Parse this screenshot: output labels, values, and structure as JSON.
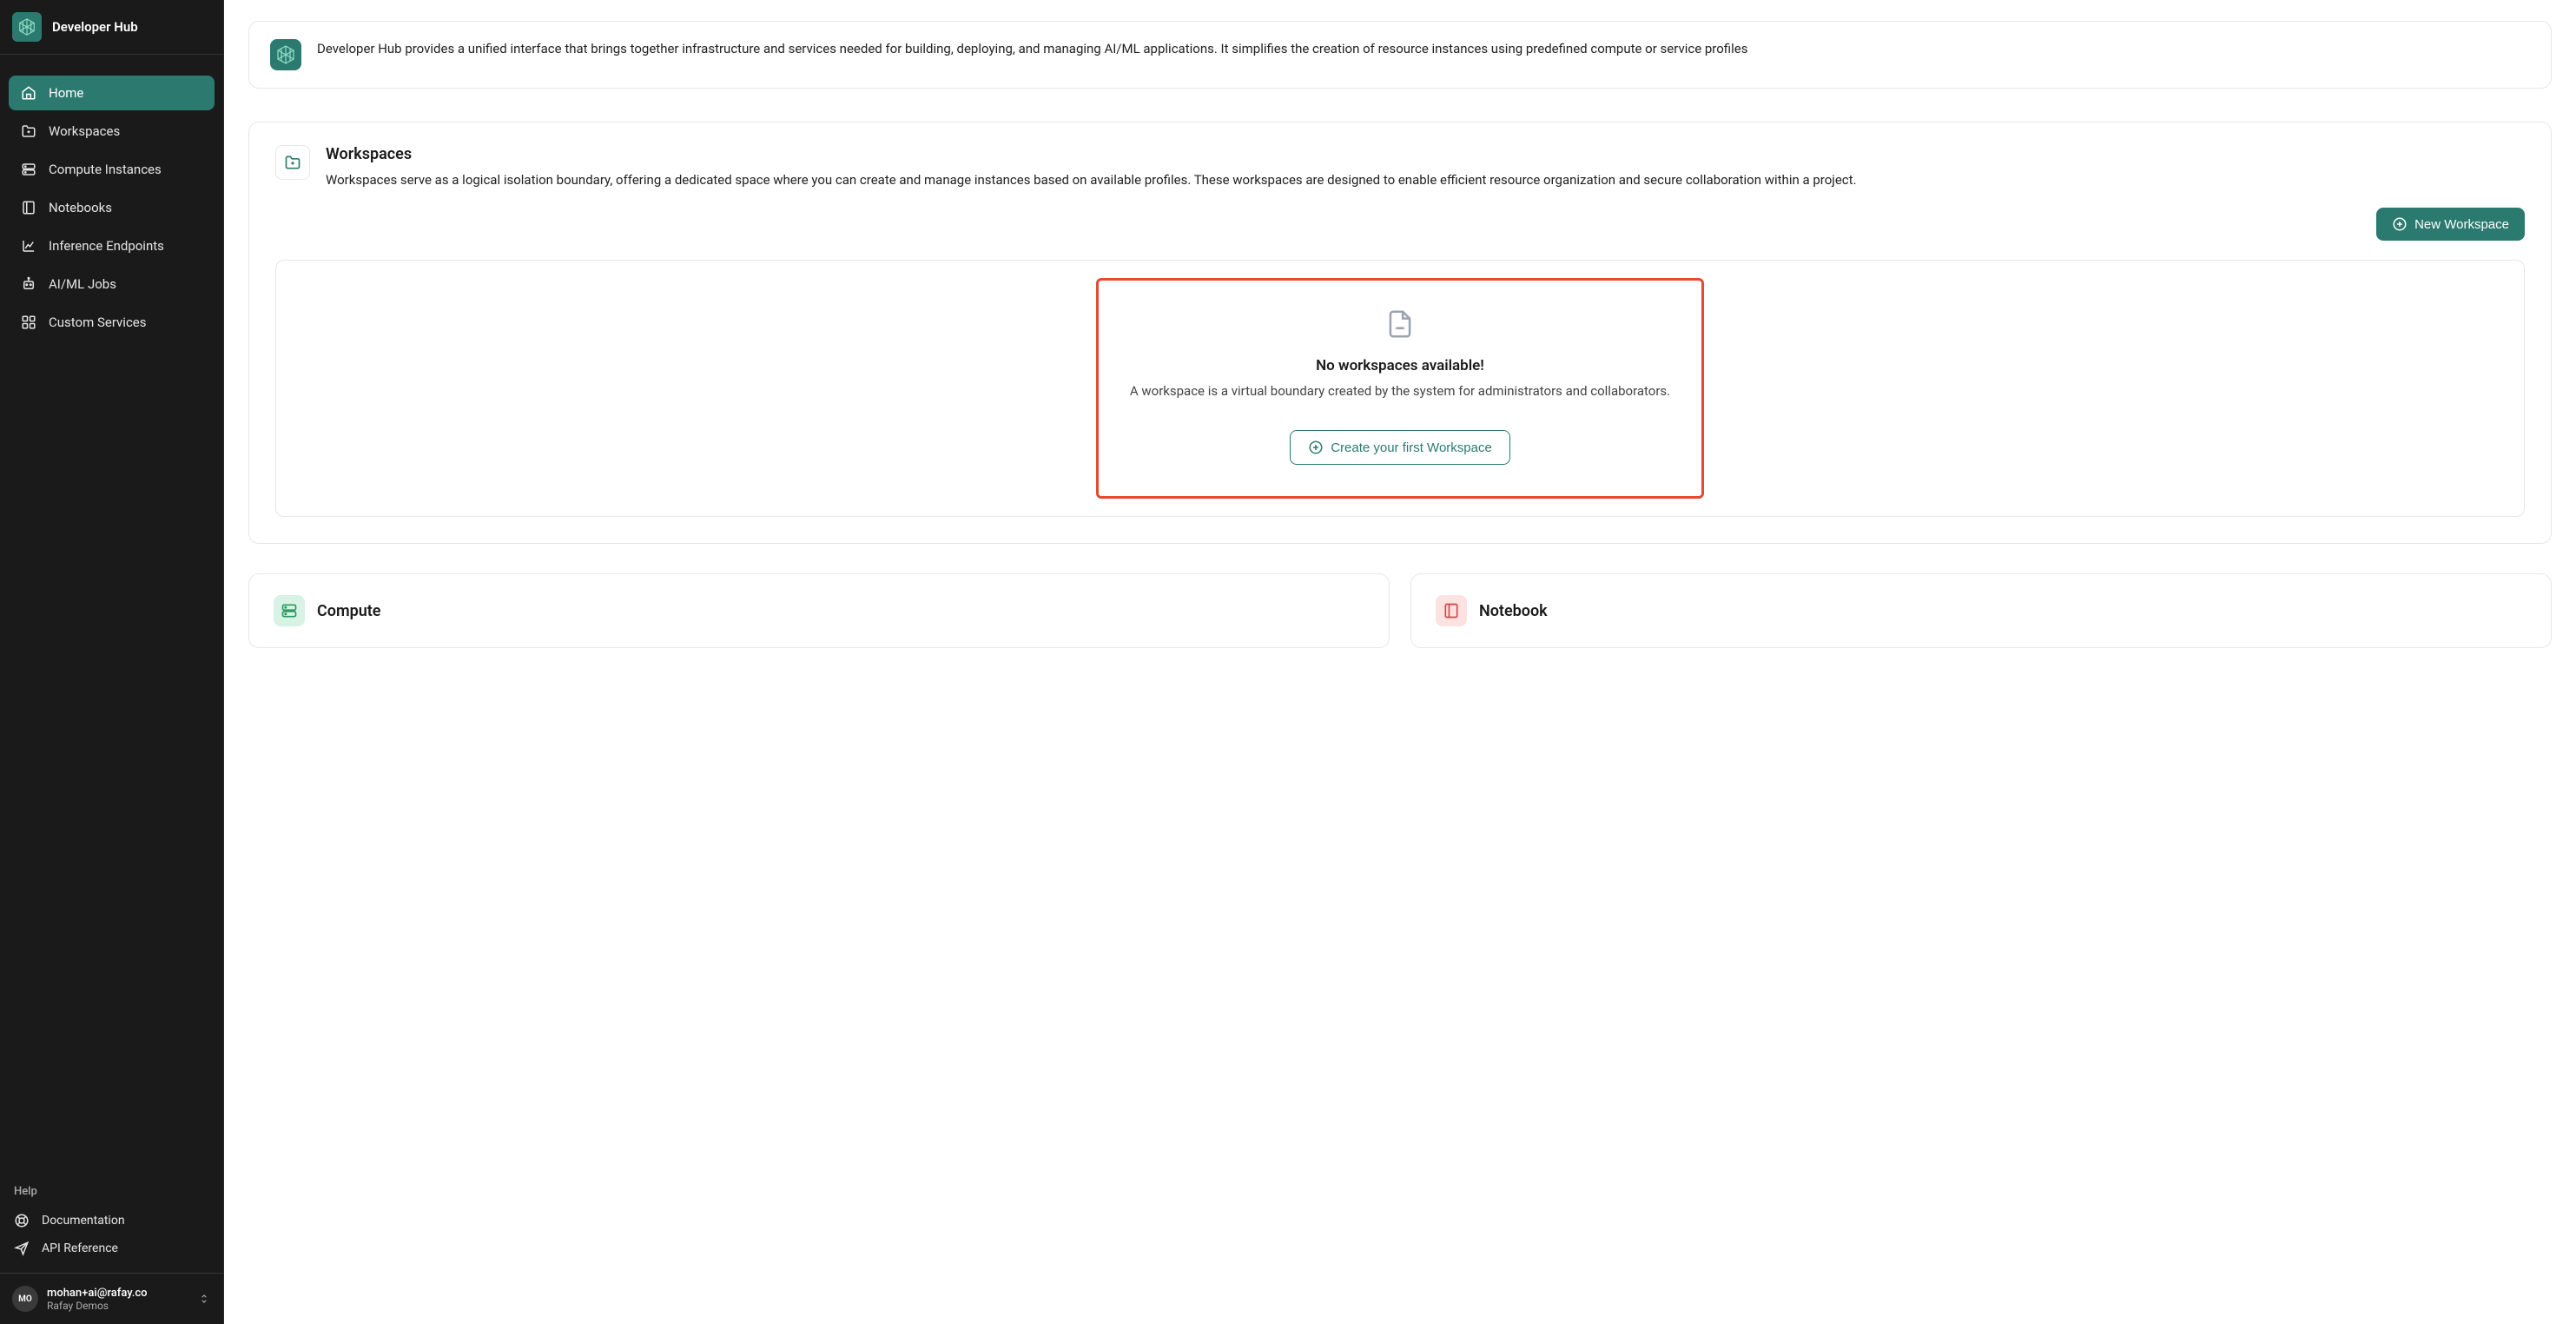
{
  "app": {
    "title": "Developer Hub"
  },
  "sidebar": {
    "items": [
      {
        "label": "Home"
      },
      {
        "label": "Workspaces"
      },
      {
        "label": "Compute Instances"
      },
      {
        "label": "Notebooks"
      },
      {
        "label": "Inference Endpoints"
      },
      {
        "label": "AI/ML Jobs"
      },
      {
        "label": "Custom Services"
      }
    ],
    "help_heading": "Help",
    "help_items": [
      {
        "label": "Documentation"
      },
      {
        "label": "API Reference"
      }
    ]
  },
  "user": {
    "initials": "MO",
    "email": "mohan+ai@rafay.co",
    "org": "Rafay Demos"
  },
  "intro": {
    "text": "Developer Hub provides a unified interface that brings together infrastructure and services needed for building, deploying, and managing AI/ML applications. It simplifies the creation of resource instances using predefined compute or service profiles"
  },
  "workspaces": {
    "title": "Workspaces",
    "desc": "Workspaces serve as a logical isolation boundary, offering a dedicated space where you can create and manage instances based on available profiles. These workspaces are designed to enable efficient resource organization and secure collaboration within a project.",
    "new_button": "New Workspace",
    "empty_title": "No workspaces available!",
    "empty_desc": "A workspace is a virtual boundary created by the system for administrators and collaborators.",
    "create_button": "Create your first Workspace"
  },
  "bottom": {
    "compute_title": "Compute",
    "notebook_title": "Notebook"
  }
}
